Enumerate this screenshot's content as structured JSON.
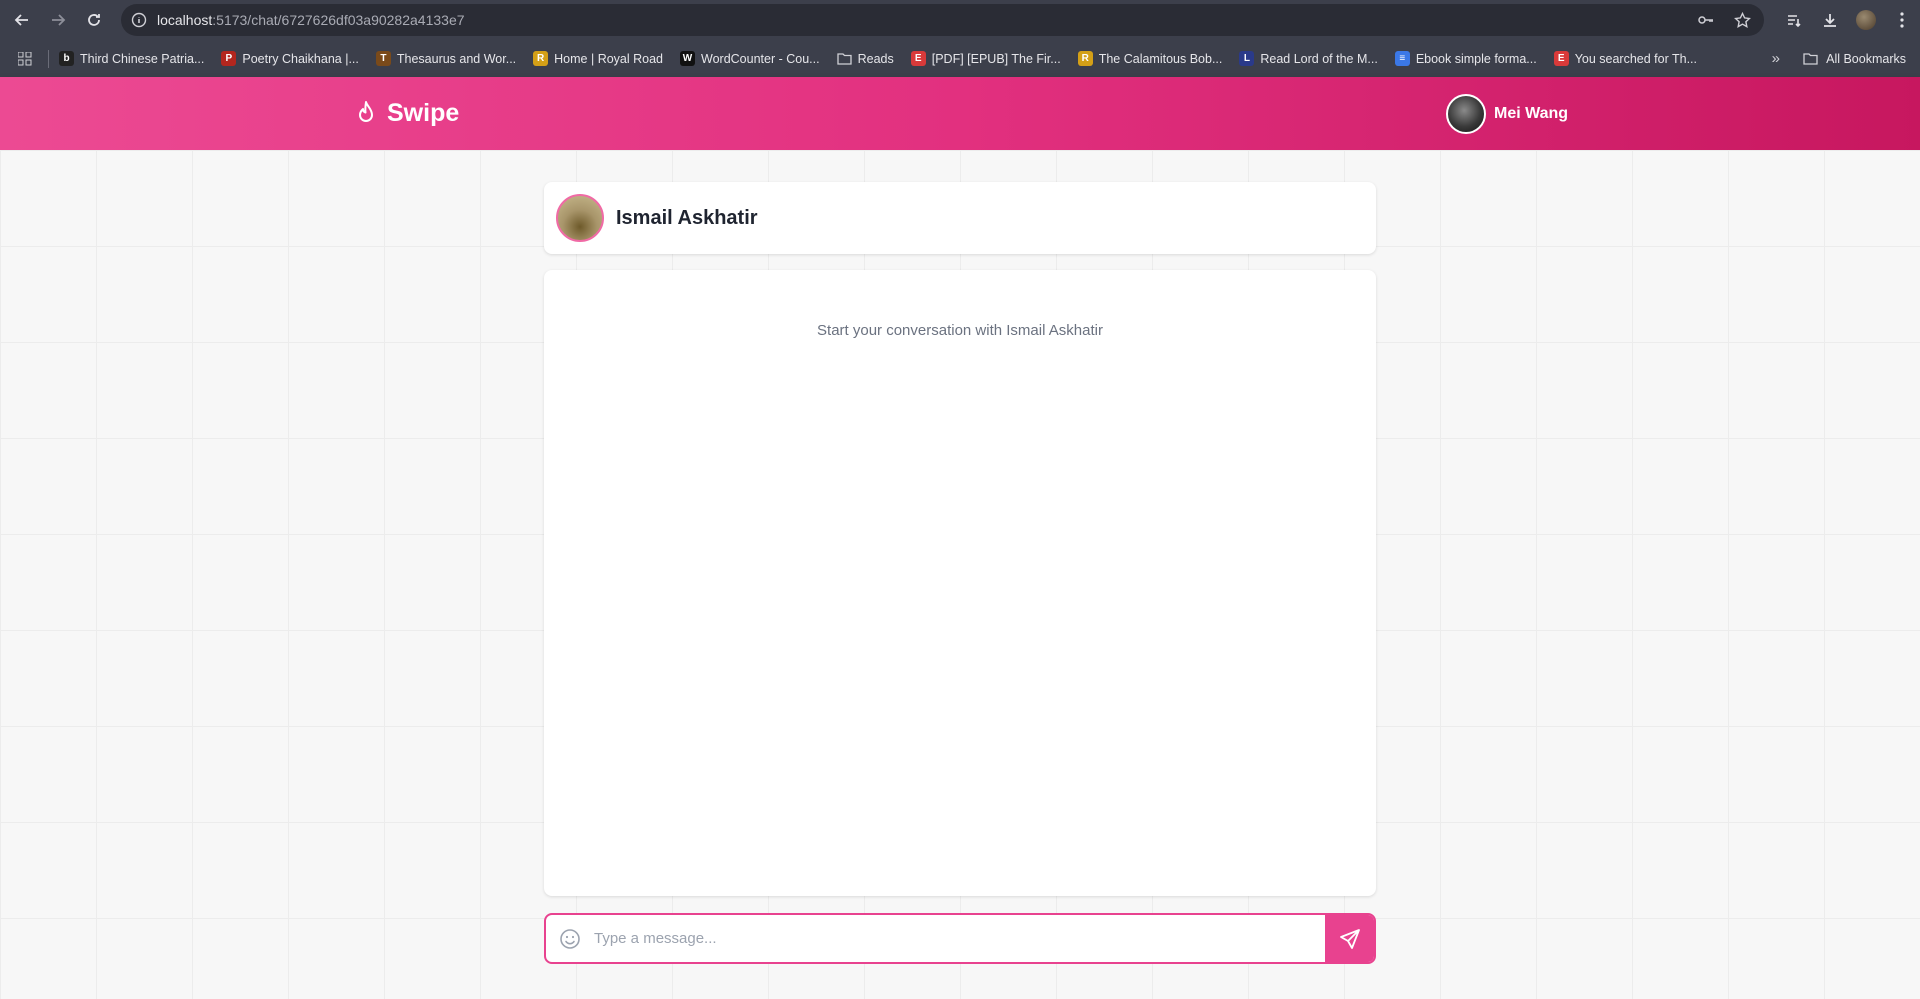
{
  "browser": {
    "url_host": "localhost",
    "url_path": ":5173/chat/6727626df03a90282a4133e7"
  },
  "bookmarks": {
    "items": [
      {
        "label": "Third Chinese Patria...",
        "icon": "b",
        "color": "#222222"
      },
      {
        "label": "Poetry Chaikhana |...",
        "icon": "P",
        "color": "#b3261e"
      },
      {
        "label": "Thesaurus and Wor...",
        "icon": "T",
        "color": "#7a4a1a"
      },
      {
        "label": "Home | Royal Road",
        "icon": "R",
        "color": "#d4a017"
      },
      {
        "label": "WordCounter - Cou...",
        "icon": "W",
        "color": "#111111"
      },
      {
        "label": "Reads",
        "icon": "folder",
        "color": "#3c3f4b"
      },
      {
        "label": "[PDF] [EPUB] The Fir...",
        "icon": "E",
        "color": "#d93a3a"
      },
      {
        "label": "The Calamitous Bob...",
        "icon": "R",
        "color": "#d4a017"
      },
      {
        "label": "Read Lord of the M...",
        "icon": "L",
        "color": "#2a3a8a"
      },
      {
        "label": "Ebook simple forma...",
        "icon": "≡",
        "color": "#3b78e7"
      },
      {
        "label": "You searched for Th...",
        "icon": "E",
        "color": "#d93a3a"
      }
    ],
    "all_label": "All Bookmarks"
  },
  "app": {
    "brand": "Swipe",
    "user_name": "Mei Wang",
    "accent": "#e8428f"
  },
  "chat": {
    "partner_name": "Ismail Askhatir",
    "empty_text": "Start your conversation with Ismail Askhatir",
    "input_placeholder": "Type a message..."
  }
}
